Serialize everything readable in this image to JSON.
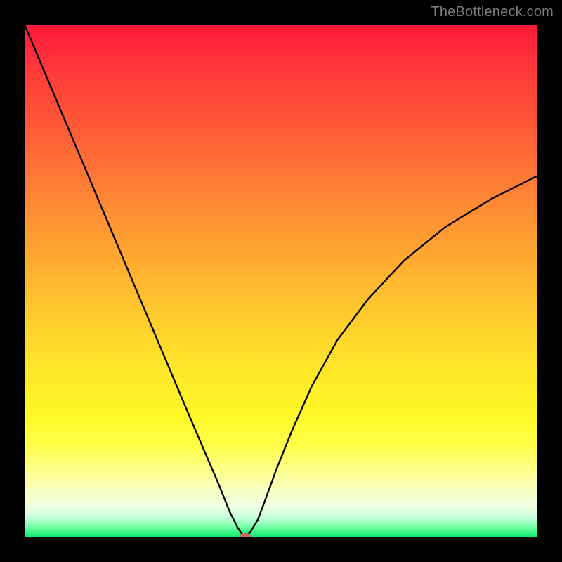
{
  "watermark": "TheBottleneck.com",
  "chart_data": {
    "type": "line",
    "title": "",
    "xlabel": "",
    "ylabel": "",
    "xlim": [
      0,
      1
    ],
    "ylim": [
      0,
      1
    ],
    "legend": false,
    "grid": false,
    "background_gradient": {
      "direction": "vertical",
      "stops": [
        {
          "pos": 0.0,
          "color": "#ff183a"
        },
        {
          "pos": 0.5,
          "color": "#ffbd2f"
        },
        {
          "pos": 0.82,
          "color": "#ffff4a"
        },
        {
          "pos": 1.0,
          "color": "#14e56f"
        }
      ]
    },
    "series": [
      {
        "name": "bottleneck-curve",
        "stroke": "#000000",
        "stroke_width": 2.4,
        "x": [
          0.0,
          0.04,
          0.08,
          0.12,
          0.16,
          0.2,
          0.24,
          0.28,
          0.32,
          0.35,
          0.38,
          0.4,
          0.415,
          0.425,
          0.43,
          0.44,
          0.455,
          0.47,
          0.49,
          0.52,
          0.56,
          0.61,
          0.67,
          0.74,
          0.82,
          0.91,
          1.0
        ],
        "y": [
          1.0,
          0.905,
          0.81,
          0.715,
          0.62,
          0.525,
          0.43,
          0.335,
          0.24,
          0.17,
          0.1,
          0.05,
          0.02,
          0.005,
          0.002,
          0.01,
          0.035,
          0.075,
          0.13,
          0.205,
          0.295,
          0.385,
          0.465,
          0.54,
          0.605,
          0.66,
          0.705
        ]
      }
    ],
    "annotations": [
      {
        "name": "min-marker",
        "type": "marker",
        "shape": "rounded-rect",
        "x": 0.43,
        "y": 0.002,
        "color": "#c07060"
      }
    ]
  }
}
